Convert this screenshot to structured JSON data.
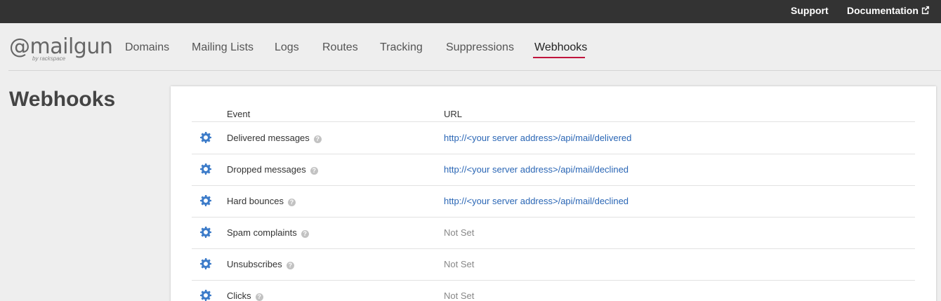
{
  "topbar": {
    "support": "Support",
    "documentation": "Documentation"
  },
  "logo": {
    "text": "@mailgun",
    "tagline": "by rackspace"
  },
  "nav": {
    "items": [
      "Domains",
      "Mailing Lists",
      "Logs",
      "Routes",
      "Tracking",
      "Suppressions",
      "Webhooks"
    ],
    "active": "Webhooks"
  },
  "page": {
    "title": "Webhooks"
  },
  "table": {
    "headers": {
      "event": "Event",
      "url": "URL"
    },
    "rows": [
      {
        "event": "Delivered messages",
        "url": "http://<your server address>/api/mail/delivered",
        "set": true
      },
      {
        "event": "Dropped messages",
        "url": "http://<your server address>/api/mail/declined",
        "set": true
      },
      {
        "event": "Hard bounces",
        "url": "http://<your server address>/api/mail/declined",
        "set": true
      },
      {
        "event": "Spam complaints",
        "url": "Not Set",
        "set": false
      },
      {
        "event": "Unsubscribes",
        "url": "Not Set",
        "set": false
      },
      {
        "event": "Clicks",
        "url": "Not Set",
        "set": false
      }
    ]
  },
  "colors": {
    "topbar": "#333333",
    "accent": "#c0143c",
    "link": "#2a66b5",
    "gear": "#3d7cc9"
  }
}
